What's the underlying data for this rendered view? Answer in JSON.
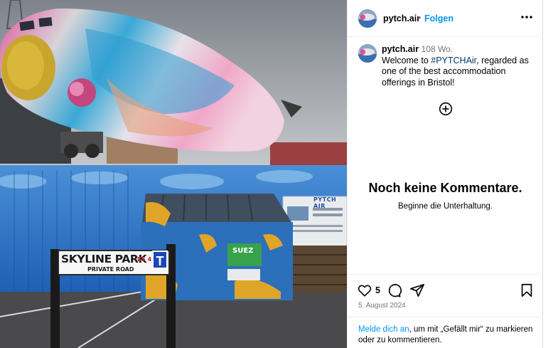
{
  "post": {
    "username": "pytch.air",
    "follow_label": "Folgen",
    "separator": "•",
    "caption": {
      "time": "108 Wo.",
      "text_before": "Welcome to ",
      "hashtag": "#PYTCHAir",
      "text_after": ", regarded as one of the best accommodation offerings in Bristol!"
    },
    "photo": {
      "sign_name": "SKYLINE PARK",
      "sign_sub": "PRIVATE ROAD",
      "sign_number": "BS 4",
      "sign_letter": "T",
      "board_label": "PYTCH AIR",
      "bin_label": "SUEZ"
    }
  },
  "comments": {
    "empty_title": "Noch keine Kommentare.",
    "empty_subtitle": "Beginne die Unterhaltung."
  },
  "actions": {
    "likes_count": "5",
    "date": "5. August 2024"
  },
  "login_prompt": {
    "link": "Melde dich an",
    "rest": ", um mit „Gefällt mir“ zu markieren oder zu kommentieren."
  },
  "icons": {
    "more": "more-options-icon",
    "add": "add-circle-icon",
    "like": "heart-icon",
    "comment": "comment-icon",
    "share": "share-icon",
    "save": "bookmark-icon"
  },
  "colors": {
    "accent": "#0095f6",
    "hashtag": "#00376b",
    "muted": "#737373"
  }
}
